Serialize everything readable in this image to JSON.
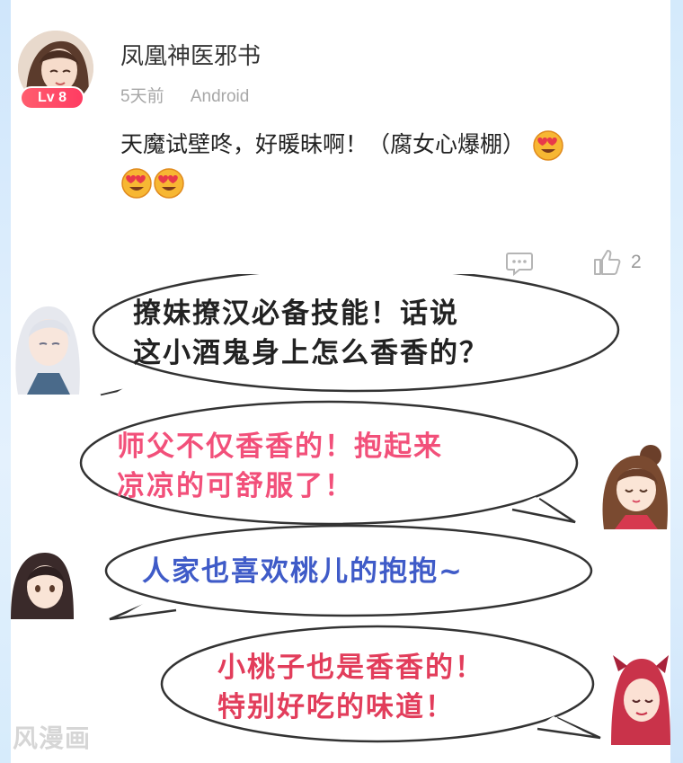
{
  "comment": {
    "username": "凤凰神医邪书",
    "level": "Lv 8",
    "time": "5天前",
    "platform": "Android",
    "text": "天魔试壁咚，好暖昧啊！（腐女心爆棚）",
    "emojis": [
      "heart-eyes-emoji",
      "heart-eyes-emoji",
      "heart-eyes-emoji"
    ],
    "like_count": "2"
  },
  "comic": {
    "bubble1": {
      "line1": "撩妹撩汉必备技能！话说",
      "line2": "这小酒鬼身上怎么香香的？",
      "color": "#222222"
    },
    "bubble2": {
      "line1": "师父不仅香香的！抱起来",
      "line2": "凉凉的可舒服了！",
      "color": "#f2507a"
    },
    "bubble3": {
      "line1": "人家也喜欢桃儿的抱抱~",
      "color": "#3f5bc8"
    },
    "bubble4": {
      "line1": "小桃子也是香香的！",
      "line2": "特别好吃的味道！",
      "color": "#e23d5b"
    },
    "watermark": "风漫画"
  }
}
